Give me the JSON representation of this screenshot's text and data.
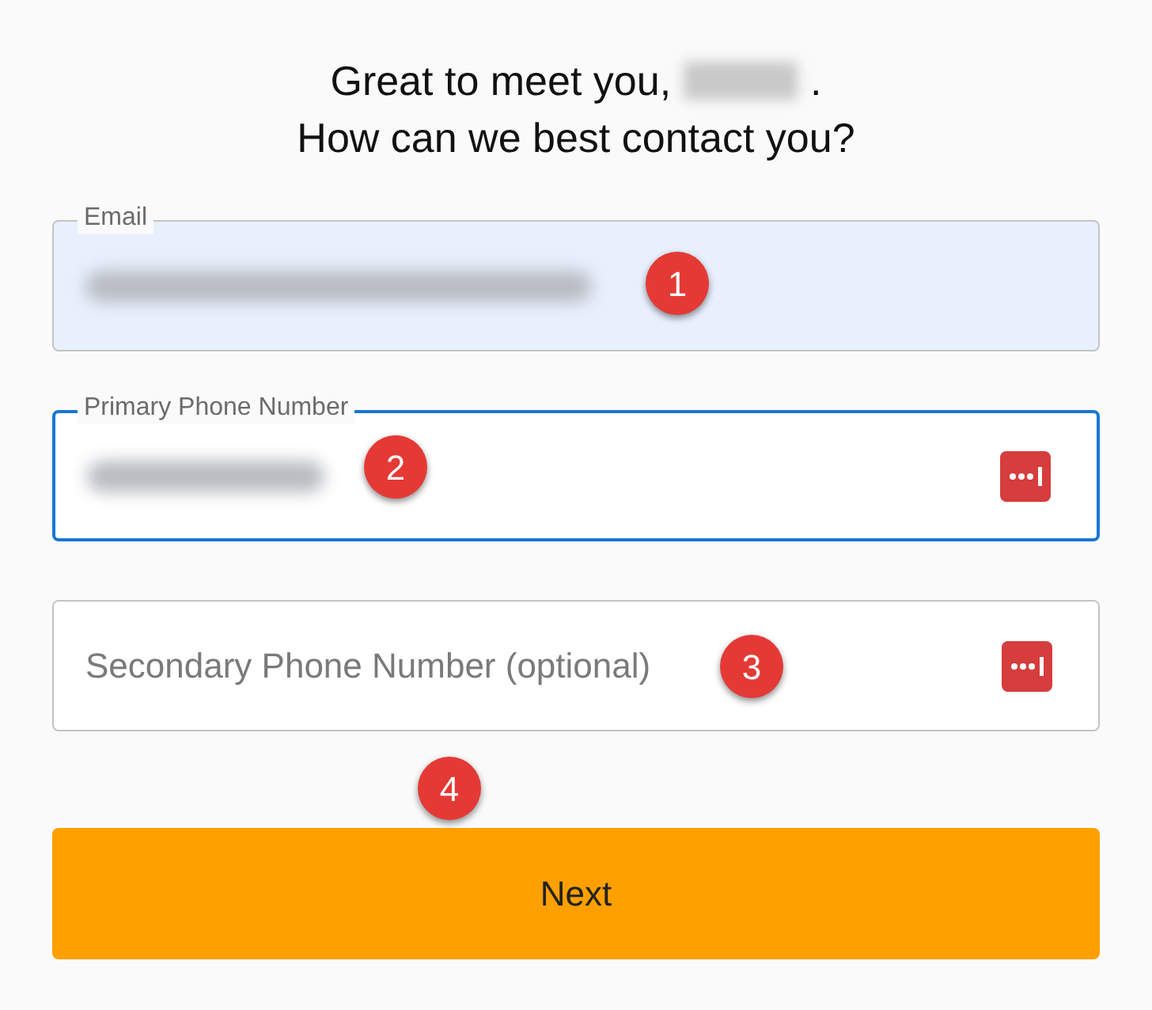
{
  "heading": {
    "line_1": "Great to meet you,",
    "line_1_end": ".",
    "name_hidden": true,
    "line_2": "How can we best contact you?"
  },
  "fields": [
    {
      "label": "Email",
      "focused": false,
      "autofilled": true,
      "value_hidden": true,
      "password_manager": false,
      "callout": "1"
    },
    {
      "label": "Primary Phone Number",
      "focused": true,
      "autofilled": false,
      "value_hidden": true,
      "password_manager": true,
      "callout": "2"
    },
    {
      "placeholder": "Secondary Phone Number (optional)",
      "focused": false,
      "autofilled": false,
      "value_hidden": false,
      "password_manager": true,
      "callout": "3"
    }
  ],
  "button": {
    "label": "Next",
    "callout": "4"
  }
}
